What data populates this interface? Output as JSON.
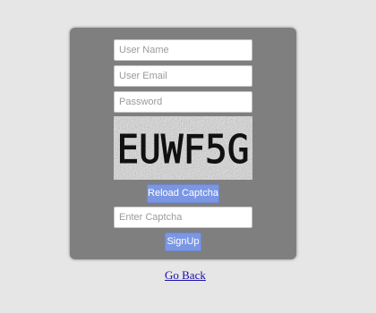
{
  "form": {
    "username_placeholder": "User Name",
    "email_placeholder": "User Email",
    "password_placeholder": "Password",
    "captcha_text": "EUWF5G",
    "reload_label": "Reload Captcha",
    "captcha_placeholder": "Enter Captcha",
    "signup_label": "SignUp"
  },
  "footer": {
    "go_back_label": "Go Back"
  },
  "colors": {
    "page_background": "#e6e6e6",
    "panel_background": "#7f7f7f",
    "button_background": "#7b97e3",
    "link": "#1a0dab"
  }
}
